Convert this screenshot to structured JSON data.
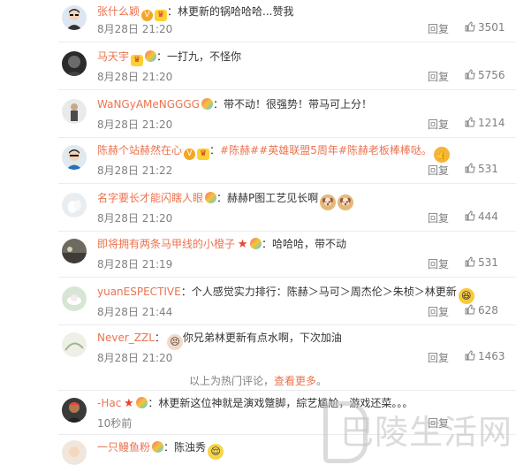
{
  "comments": [
    {
      "user": "张什么颖",
      "badges": [
        "v",
        "vip"
      ],
      "text": "林更新的锅哈哈哈...赞我",
      "time": "8月28日 21:20",
      "reply": "回复",
      "likes": "3501"
    },
    {
      "user": "马天宇",
      "badges": [
        "vip",
        "bulb"
      ],
      "text": "一打九，不怪你",
      "time": "8月28日 21:20",
      "reply": "回复",
      "likes": "5756"
    },
    {
      "user": "WaNGyAMeNGGGG",
      "badges": [
        "bulb"
      ],
      "text": "带不动！很强势！带马可上分！",
      "time": "8月28日 21:20",
      "reply": "回复",
      "likes": "1214"
    },
    {
      "user": "陈赫个站赫然在心",
      "badges": [
        "v",
        "vip"
      ],
      "text": "#陈赫##英雄联盟5周年#陈赫老板棒棒哒。",
      "time": "8月28日 21:22",
      "reply": "回复",
      "likes": "531"
    },
    {
      "user": "名字要长才能闪瞎人眼",
      "badges": [
        "bulb"
      ],
      "text": "赫赫P图工艺见长啊",
      "time": "8月28日 21:20",
      "reply": "回复",
      "likes": "444"
    },
    {
      "user": "即将拥有两条马甲线的小橙子",
      "badges": [
        "star",
        "bulb"
      ],
      "text": "哈哈哈，带不动",
      "time": "8月28日 21:19",
      "reply": "回复",
      "likes": "531"
    },
    {
      "user": "yuanESPECTIVE",
      "badges": [],
      "text": "个人感觉实力排行：陈赫＞马可＞周杰伦＞朱桢＞林更新",
      "time": "8月28日 21:44",
      "reply": "回复",
      "likes": "628"
    },
    {
      "user": "Never_ZZL",
      "badges": [],
      "text": "你兄弟林更新有点水啊，下次加油",
      "time": "8月28日 21:20",
      "reply": "回复",
      "likes": "1463"
    }
  ],
  "more_bar": {
    "prefix": "以上为热门评论，",
    "link": "查看更多",
    "suffix": "。"
  },
  "recent": [
    {
      "user": "-Hac",
      "badges": [
        "star",
        "bulb"
      ],
      "text": "林更新这位神就是演戏蹩脚，綜艺尴尬，游戏还菜。。。",
      "time": "10秒前",
      "reply": "回复"
    },
    {
      "user": "一只鳗鱼粉",
      "badges": [
        "bulb"
      ],
      "text": "陈浊秀",
      "time": "",
      "reply": ""
    }
  ],
  "watermark": "巴陵生活网",
  "colors": {
    "username": "#eb7350",
    "meta": "#808080",
    "text": "#333333"
  }
}
